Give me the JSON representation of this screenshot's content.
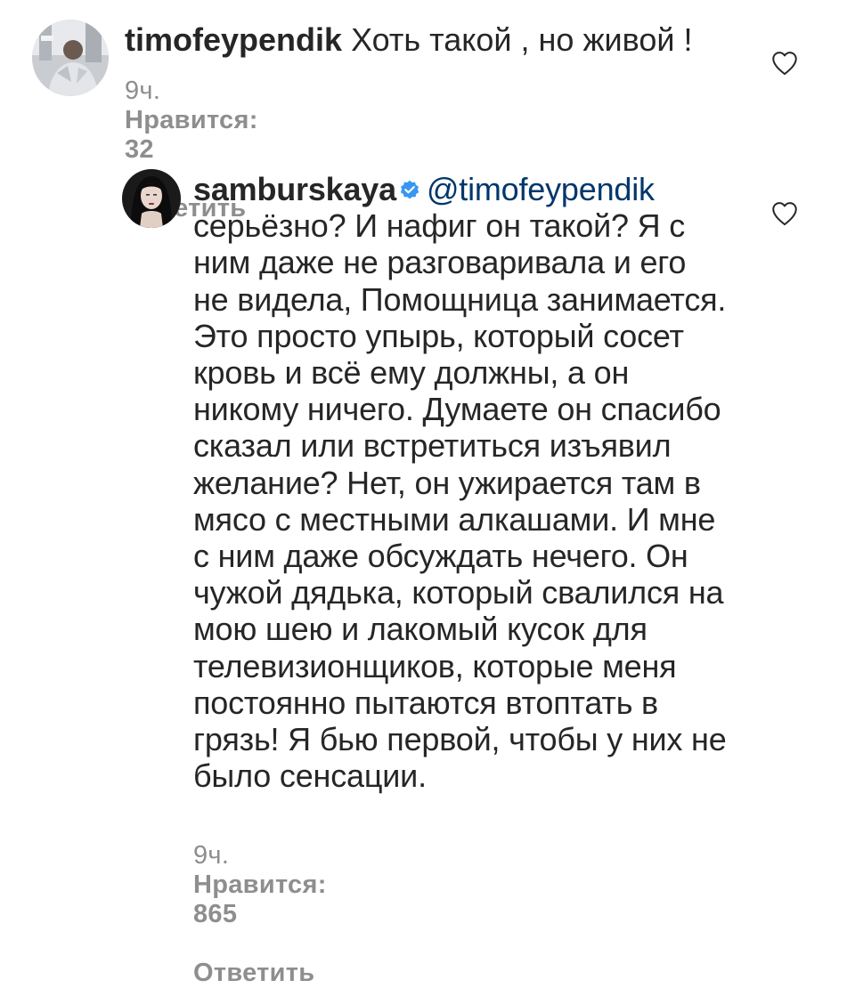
{
  "comments": [
    {
      "username": "timofeypendik",
      "text": "Хоть такой , но живой !",
      "time": "9ч.",
      "likes_label": "Нравится: 32",
      "reply_label": "Ответить"
    },
    {
      "username": "samburskaya",
      "verified": true,
      "mention": "@timofeypendik",
      "text": "серьёзно? И нафиг он такой? Я с ним даже не разговаривала и его не видела, Помощница занимается. Это просто упырь, который сосет кровь и всё ему должны, а он никому ничего. Думаете он спасибо сказал или встретиться изъявил желание? Нет, он ужирается там в мясо с местными алкашами. И мне с ним даже обсуждать нечего. Он чужой дядька, который свалился на мою шею и лакомый кусок для телевизионщиков, которые меня постоянно пытаются втоптать в грязь! Я бью первой, чтобы у них не было сенсации.",
      "time": "9ч.",
      "likes_label": "Нравится: 865",
      "reply_label": "Ответить"
    }
  ],
  "icons": {
    "like": "heart-outline-icon",
    "verified": "verified-badge-icon"
  },
  "colors": {
    "text": "#262626",
    "meta": "#8e8e8e",
    "mention": "#00376b",
    "verified": "#3897f0"
  }
}
